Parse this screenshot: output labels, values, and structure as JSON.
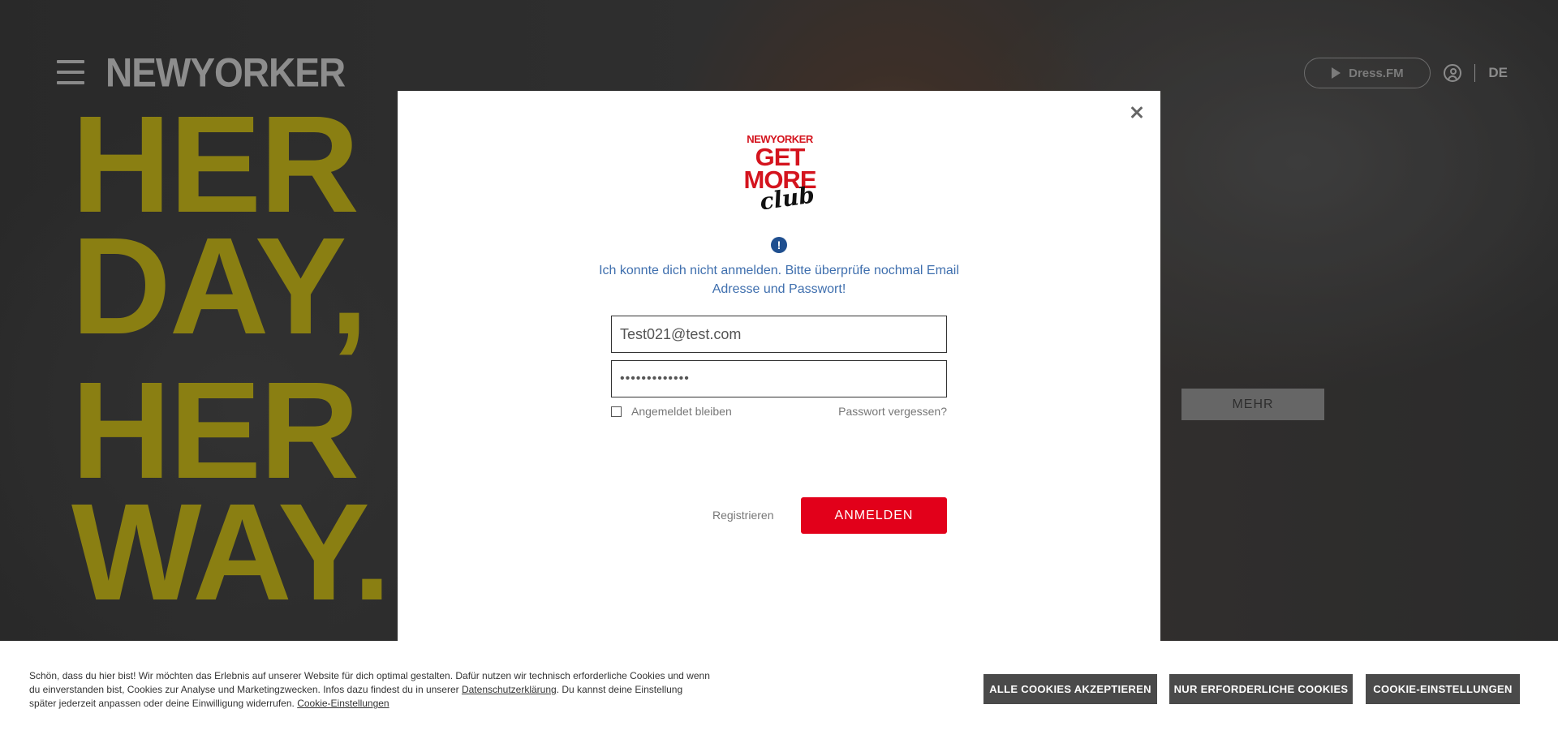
{
  "header": {
    "brand": "NEWYORKER",
    "dressfm_label": "Dress.FM",
    "language": "DE"
  },
  "hero": {
    "line1": "HER",
    "line2": "DAY,",
    "line3": "HER",
    "line4": "WAY.",
    "more_button": "MEHR"
  },
  "modal": {
    "logo": {
      "brand": "NEWYORKER",
      "get": "GET",
      "more": "MORE",
      "club": "club"
    },
    "error_message": "Ich konnte dich nicht anmelden. Bitte überprüfe nochmal Email Adresse und Passwort!",
    "email_value": "Test021@test.com",
    "password_value": "•••••••••••••",
    "remember_label": "Angemeldet bleiben",
    "forgot_label": "Passwort vergessen?",
    "register_label": "Registrieren",
    "login_label": "ANMELDEN"
  },
  "cookie": {
    "text_part1": "Schön, dass du hier bist! Wir möchten das Erlebnis auf unserer Website für dich optimal gestalten. Dafür nutzen wir technisch erforderliche Cookies und wenn du einverstanden bist, Cookies zur Analyse und Marketingzwecken. Infos dazu findest du in unserer ",
    "privacy_link": "Datenschutzerklärung",
    "text_part2": ". Du kannst deine Einstellung später jederzeit anpassen oder deine Einwilligung widerrufen. ",
    "settings_link": "Cookie-Einstellungen",
    "accept_all": "ALLE COOKIES AKZEPTIEREN",
    "required_only": "NUR ERFORDERLICHE COOKIES",
    "settings_button": "COOKIE-EINSTELLUNGEN"
  },
  "colors": {
    "accent_red": "#e2001a",
    "hero_yellow": "#8a7f12",
    "error_blue": "#3f6fae"
  }
}
